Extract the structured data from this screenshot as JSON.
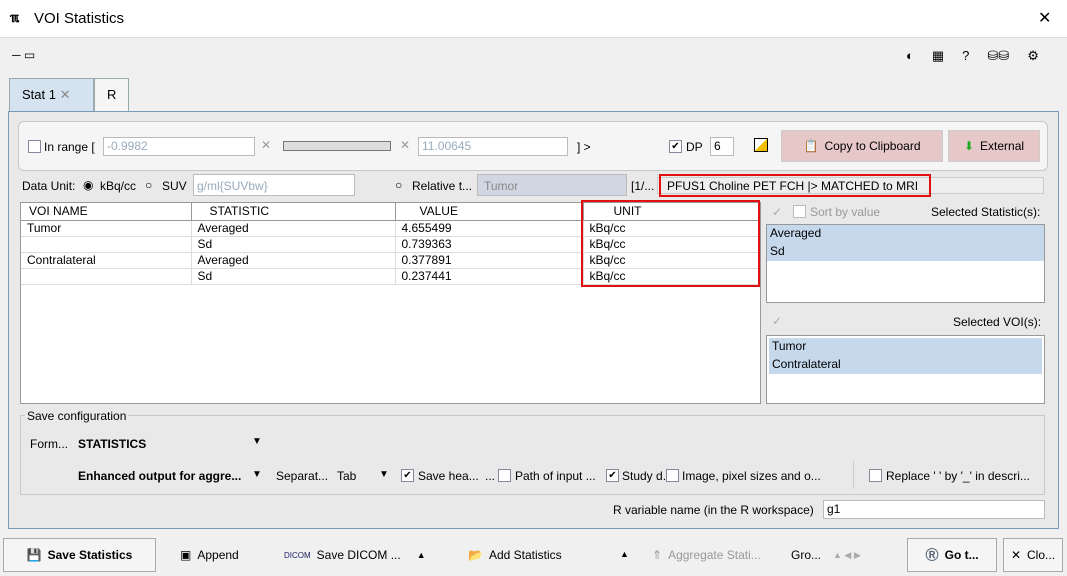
{
  "window": {
    "title": "VOI Statistics",
    "close": "✕"
  },
  "tabs": [
    {
      "label": "Stat 1",
      "close": "✕"
    },
    {
      "label": "R"
    }
  ],
  "range": {
    "label": "In range [",
    "min": "-0.9982",
    "max": "11.00645",
    "close": "] >",
    "checked": false
  },
  "dp": {
    "label": "DP",
    "value": "6",
    "checked": true
  },
  "buttons": {
    "copy": "Copy to Clipboard",
    "external": "External"
  },
  "data_unit": {
    "label": "Data Unit:",
    "kbq": "kBq/cc",
    "suv": "SUV",
    "suv_type": "g/ml{SUVbw}",
    "relative": "Relative t...",
    "relative_to": "Tumor",
    "page": "[1/...",
    "series": "PFUS1 Choline PET FCH |> MATCHED to MRI"
  },
  "table": {
    "headers": [
      "VOI NAME",
      "STATISTIC",
      "VALUE",
      "UNIT"
    ],
    "rows": [
      [
        "Tumor",
        "Averaged",
        "4.655499",
        "kBq/cc"
      ],
      [
        "",
        "Sd",
        "0.739363",
        "kBq/cc"
      ],
      [
        "Contralateral",
        "Averaged",
        "0.377891",
        "kBq/cc"
      ],
      [
        "",
        "Sd",
        "0.237441",
        "kBq/cc"
      ]
    ]
  },
  "side": {
    "sort": "Sort by value",
    "sel_stat": "Selected Statistic(s):",
    "stats": [
      "Averaged",
      "Sd"
    ],
    "sel_voi": "Selected VOI(s):",
    "vois": [
      "Tumor",
      "Contralateral"
    ]
  },
  "save_config": {
    "legend": "Save configuration",
    "format_label": "Form...",
    "format": "STATISTICS",
    "enhanced": "Enhanced output for aggre...",
    "separator_label": "Separat...",
    "separator": "Tab",
    "save_header": "Save hea...",
    "dots": "...",
    "path_input": "Path of input ...",
    "study": "Study d...",
    "image": "Image, pixel sizes and o...",
    "replace": "Replace ' ' by '_' in descri..."
  },
  "r_var": {
    "label": "R variable name (in the R workspace)",
    "value": "g1"
  },
  "bottom": {
    "save": "Save Statistics",
    "append": "Append",
    "dicom": "Save DICOM ...",
    "add": "Add Statistics",
    "aggregate": "Aggregate Stati...",
    "group": "Gro...",
    "goto": "Go t...",
    "close": "Clo..."
  }
}
